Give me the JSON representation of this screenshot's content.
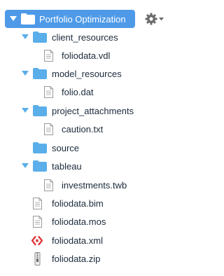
{
  "tree": {
    "root": {
      "label": "Portfolio Optimization",
      "expanded": true,
      "icon": "folder-icon"
    },
    "items": [
      {
        "kind": "folder",
        "label": "client_resources",
        "expanded": true,
        "icon": "folder-icon"
      },
      {
        "kind": "file",
        "label": "foliodata.vdl",
        "icon": "document-icon"
      },
      {
        "kind": "folder",
        "label": "model_resources",
        "expanded": true,
        "icon": "folder-icon"
      },
      {
        "kind": "file",
        "label": "folio.dat",
        "icon": "document-icon"
      },
      {
        "kind": "folder",
        "label": "project_attachments",
        "expanded": true,
        "icon": "folder-icon"
      },
      {
        "kind": "file",
        "label": "caution.txt",
        "icon": "document-icon"
      },
      {
        "kind": "folder",
        "label": "source",
        "expanded": false,
        "icon": "folder-icon"
      },
      {
        "kind": "folder",
        "label": "tableau",
        "expanded": true,
        "icon": "folder-icon"
      },
      {
        "kind": "file",
        "label": "investments.twb",
        "icon": "document-icon"
      },
      {
        "kind": "file",
        "label": "foliodata.bim",
        "icon": "document-icon"
      },
      {
        "kind": "file",
        "label": "foliodata.mos",
        "icon": "document-icon"
      },
      {
        "kind": "file",
        "label": "foliodata.xml",
        "icon": "xml-file-icon"
      },
      {
        "kind": "file",
        "label": "foliodata.zip",
        "icon": "zip-file-icon"
      }
    ]
  },
  "settings": {
    "icon": "gear-icon",
    "dropdown_icon": "chevron-down-icon"
  },
  "colors": {
    "selection": "#4e9ae8",
    "folder": "#5aaeea",
    "caret": "#5aaeea",
    "text": "#1a2a3a",
    "xml_icon": "#e0393a",
    "gear": "#6b6b6b"
  }
}
